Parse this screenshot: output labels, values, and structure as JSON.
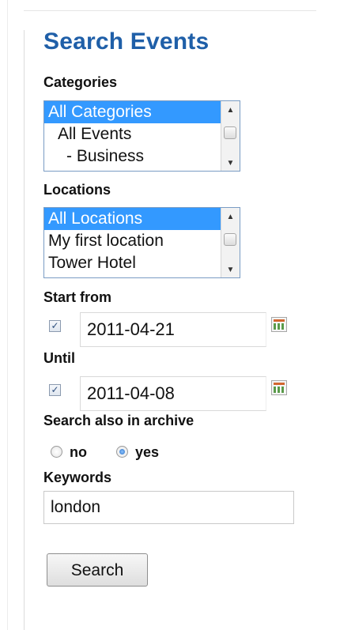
{
  "title": "Search Events",
  "categories": {
    "label": "Categories",
    "options": [
      "All Categories",
      "All Events",
      "- Business"
    ],
    "selected_index": 0
  },
  "locations": {
    "label": "Locations",
    "options": [
      "All Locations",
      "My first location",
      "Tower Hotel"
    ],
    "selected_index": 0
  },
  "start_from": {
    "label": "Start from",
    "checked": true,
    "value": "2011-04-21"
  },
  "until": {
    "label": "Until",
    "checked": true,
    "value": "2011-04-08"
  },
  "archive": {
    "label": "Search also in archive",
    "options": [
      "no",
      "yes"
    ],
    "selected": "yes"
  },
  "keywords": {
    "label": "Keywords",
    "value": "london"
  },
  "search_button": "Search",
  "icons": {
    "scroll_up": "▲",
    "scroll_down": "▼",
    "check": "✓"
  }
}
